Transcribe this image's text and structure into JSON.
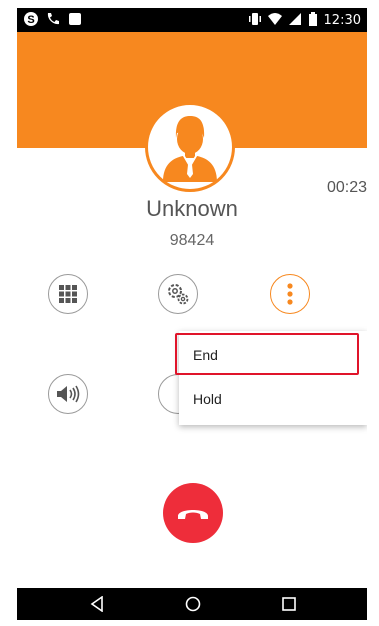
{
  "status_bar": {
    "time": "12:30",
    "icons": [
      "skype-icon",
      "phone-icon",
      "square-notification-icon",
      "vibrate-icon",
      "wifi-icon",
      "signal-icon",
      "battery-icon"
    ]
  },
  "caller": {
    "name": "Unknown",
    "number": "98424",
    "duration": "00:23"
  },
  "controls": {
    "row1": [
      "keypad-icon",
      "settings-icon",
      "more-options-icon"
    ],
    "row2": [
      "speaker-icon",
      "hidden-partial-button"
    ]
  },
  "menu": {
    "items": [
      {
        "label": "End"
      },
      {
        "label": "Hold"
      }
    ]
  },
  "nav_bar": {
    "buttons": [
      "back-icon",
      "home-icon",
      "recents-icon"
    ]
  },
  "colors": {
    "accent": "#f7881f",
    "end_call": "#ee2d3a",
    "highlight": "#e0142a"
  }
}
